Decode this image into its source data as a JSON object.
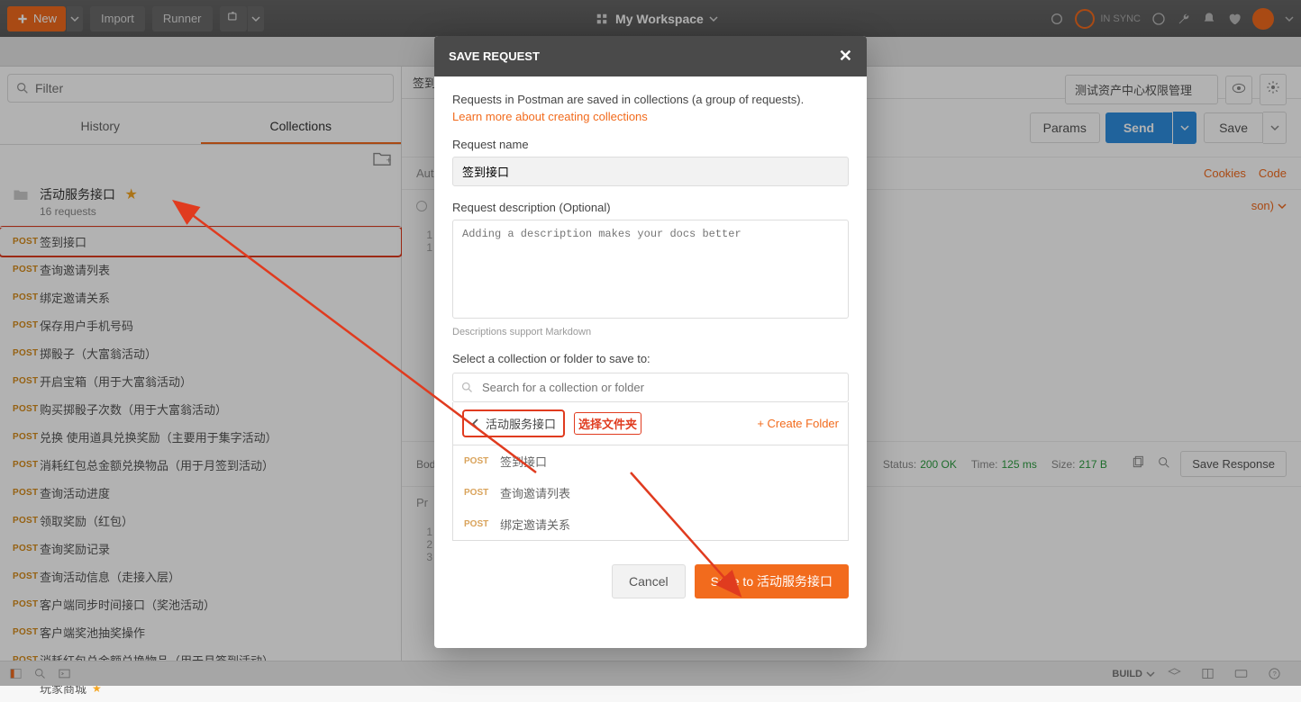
{
  "topbar": {
    "new": "New",
    "import": "Import",
    "runner": "Runner",
    "workspace": "My Workspace",
    "sync_label": "IN SYNC"
  },
  "sidebar": {
    "filter_placeholder": "Filter",
    "tabs": {
      "history": "History",
      "collections": "Collections"
    },
    "collection": {
      "name": "活动服务接口",
      "sub": "16 requests"
    },
    "items": [
      {
        "method": "POST",
        "name": "签到接口",
        "hl": true
      },
      {
        "method": "POST",
        "name": "查询邀请列表"
      },
      {
        "method": "POST",
        "name": "绑定邀请关系"
      },
      {
        "method": "POST",
        "name": "保存用户手机号码"
      },
      {
        "method": "POST",
        "name": "掷骰子（大富翁活动）"
      },
      {
        "method": "POST",
        "name": "开启宝箱（用于大富翁活动）"
      },
      {
        "method": "POST",
        "name": "购买掷骰子次数（用于大富翁活动）"
      },
      {
        "method": "POST",
        "name": "兑换 使用道具兑换奖励（主要用于集字活动）"
      },
      {
        "method": "POST",
        "name": "消耗红包总金额兑换物品（用于月签到活动）"
      },
      {
        "method": "POST",
        "name": "查询活动进度"
      },
      {
        "method": "POST",
        "name": "领取奖励（红包）"
      },
      {
        "method": "POST",
        "name": "查询奖励记录"
      },
      {
        "method": "POST",
        "name": "查询活动信息（走接入层）"
      },
      {
        "method": "POST",
        "name": "客户端同步时间接口（奖池活动）"
      },
      {
        "method": "POST",
        "name": "客户端奖池抽奖操作"
      },
      {
        "method": "POST",
        "name": "消耗红包总金额兑换物品（用于月签到活动）"
      },
      {
        "method": "",
        "name": "玩家商城",
        "star": true
      }
    ]
  },
  "request": {
    "tab_prefix": "签到",
    "auth_tab": "Auth",
    "body_tab": "Body",
    "env_name": "测试资产中心权限管理",
    "params": "Params",
    "send": "Send",
    "save": "Save",
    "body_json": "son)",
    "cookies": "Cookies",
    "code": "Code",
    "pretty": "Pr",
    "status_label": "Status:",
    "status_value": "200 OK",
    "time_label": "Time:",
    "time_value": "125 ms",
    "size_label": "Size:",
    "size_value": "217 B",
    "save_response": "Save Response",
    "body_lines": [
      "1",
      "1"
    ],
    "resp_lines": [
      "1",
      "2",
      "3"
    ]
  },
  "modal": {
    "title": "SAVE REQUEST",
    "desc": "Requests in Postman are saved in collections (a group of requests).",
    "learn_link": "Learn more about creating collections",
    "name_label": "Request name",
    "name_value": "签到接口",
    "desc_label": "Request description (Optional)",
    "desc_placeholder": "Adding a description makes your docs better",
    "md_hint": "Descriptions support Markdown",
    "select_label": "Select a collection or folder to save to:",
    "search_placeholder": "Search for a collection or folder",
    "breadcrumb": "活动服务接口",
    "annotation": "选择文件夹",
    "create_folder": "+ Create Folder",
    "folder_items": [
      {
        "method": "POST",
        "name": "签到接口"
      },
      {
        "method": "POST",
        "name": "查询邀请列表"
      },
      {
        "method": "POST",
        "name": "绑定邀请关系"
      }
    ],
    "cancel": "Cancel",
    "save_to": "Save to 活动服务接口"
  },
  "statusbar": {
    "build": "BUILD"
  }
}
